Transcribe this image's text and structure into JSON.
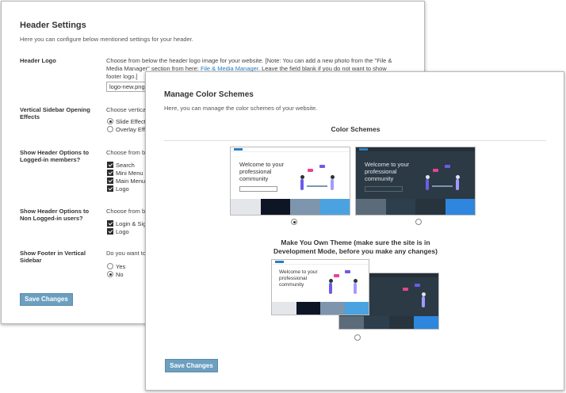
{
  "header_settings": {
    "title": "Header Settings",
    "description": "Here you can configure below mentioned settings for your header.",
    "logo": {
      "label": "Header Logo",
      "help_line1": "Choose from below the header logo image for your website. [Note: You can add a new photo from the \"File &",
      "help_line2": "Media Manager\" section from here: ",
      "help_link": "File & Media Manager",
      "help_line2_end": ". Leave the field blank if you do not want to show",
      "help_line3": "footer logo.]",
      "input_value": "logo-new.png"
    },
    "sidebar_effects": {
      "label_line1": "Vertical Sidebar Opening",
      "label_line2": "Effects",
      "help": "Choose vertica",
      "options": [
        "Slide Effect",
        "Overlay Effe"
      ],
      "selected": 0
    },
    "logged_in": {
      "label_line1": "Show Header Options to",
      "label_line2": "Logged-in members?",
      "help": "Choose from b",
      "options": [
        "Search",
        "Mini Menu",
        "Main Menu",
        "Logo"
      ]
    },
    "non_logged_in": {
      "label_line1": "Show Header Options to",
      "label_line2": "Non Logged-in users?",
      "help": "Choose from b",
      "options": [
        "Login & Sig",
        "Logo"
      ]
    },
    "footer_sidebar": {
      "label_line1": "Show Footer in Vertical",
      "label_line2": "Sidebar",
      "help": "Do you want to",
      "options": [
        "Yes",
        "No"
      ],
      "selected": 1
    },
    "save_label": "Save Changes"
  },
  "color_schemes": {
    "title": "Manage Color Schemes",
    "description": "Here, you can manage the color schemes of your website.",
    "section_title": "Color Schemes",
    "hero_line1": "Welcome to your",
    "hero_line2": "professional",
    "hero_line3": "community",
    "light_swatches": [
      "#e4e6ea",
      "#0e1525",
      "#7d95ad",
      "#4aa3e0"
    ],
    "dark_swatches": [
      "#5b6b7a",
      "#2d3f4c",
      "#27343e",
      "#2e86de"
    ],
    "custom_title_line1": "Make You Own Theme (make sure the site is in",
    "custom_title_line2": "Development Mode, before you make any changes)",
    "save_label": "Save Changes",
    "selected_scheme": 0
  }
}
